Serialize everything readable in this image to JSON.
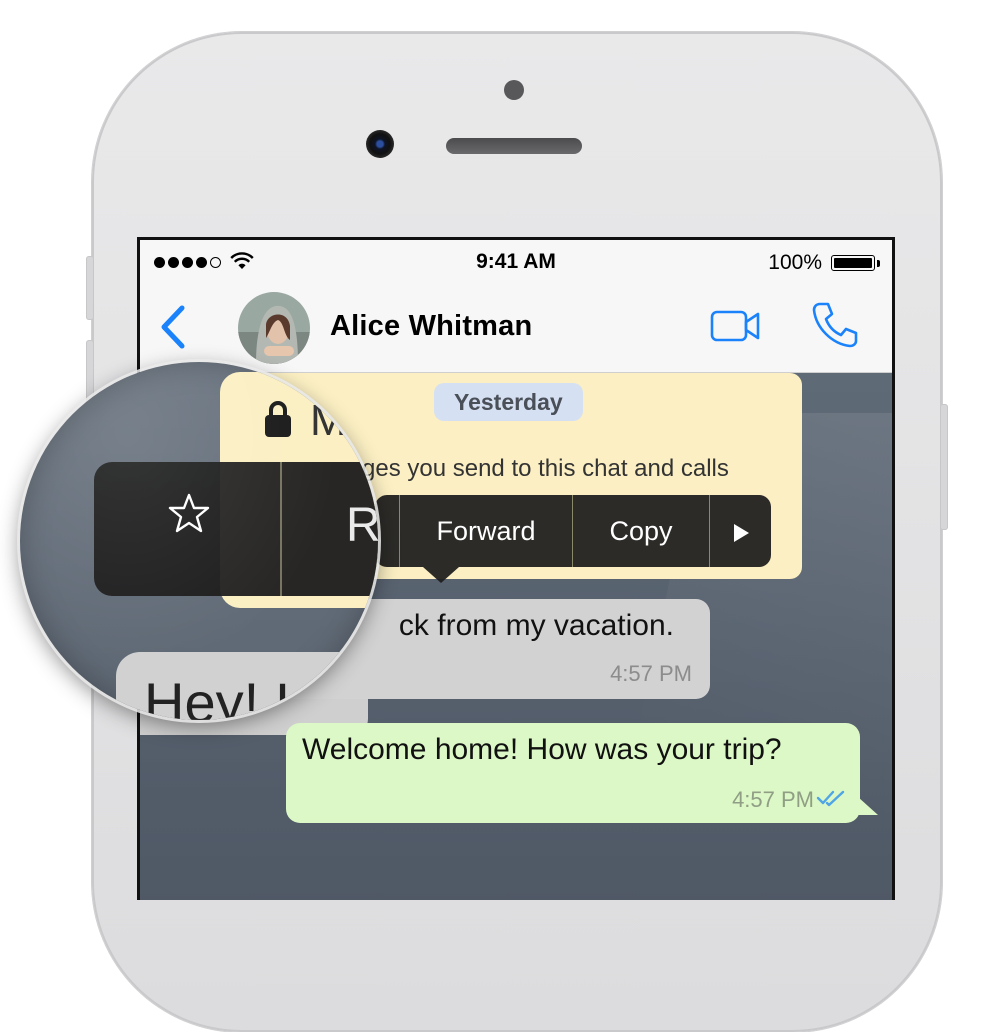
{
  "status_bar": {
    "time": "9:41 AM",
    "battery_percent": "100%",
    "signal_bars_filled": 4,
    "signal_bars_total": 5
  },
  "nav": {
    "contact_name": "Alice Whitman",
    "back_icon": "chevron-left-icon",
    "video_icon": "video-camera-icon",
    "call_icon": "phone-icon",
    "accent_color": "#1a82fb"
  },
  "chat": {
    "date_separator": "Yesterday",
    "encryption_notice": {
      "visible_fragment": "ges you send to this chat and calls",
      "magnified_fragment": "M",
      "icon": "lock-icon"
    },
    "context_menu": {
      "items": [
        "Forward",
        "Copy"
      ],
      "magnified_partial_item": "R",
      "star_icon": "star-icon",
      "more_icon": "play-arrow-icon"
    },
    "incoming_message": {
      "text": "ck from my vacation.",
      "time": "4:57 PM",
      "magnified_partial_text": "Hey! I"
    },
    "outgoing_message": {
      "text": "Welcome home! How was your trip?",
      "time": "4:57 PM",
      "status_icon": "double-check-icon",
      "status_color": "#4fa5e6"
    }
  }
}
